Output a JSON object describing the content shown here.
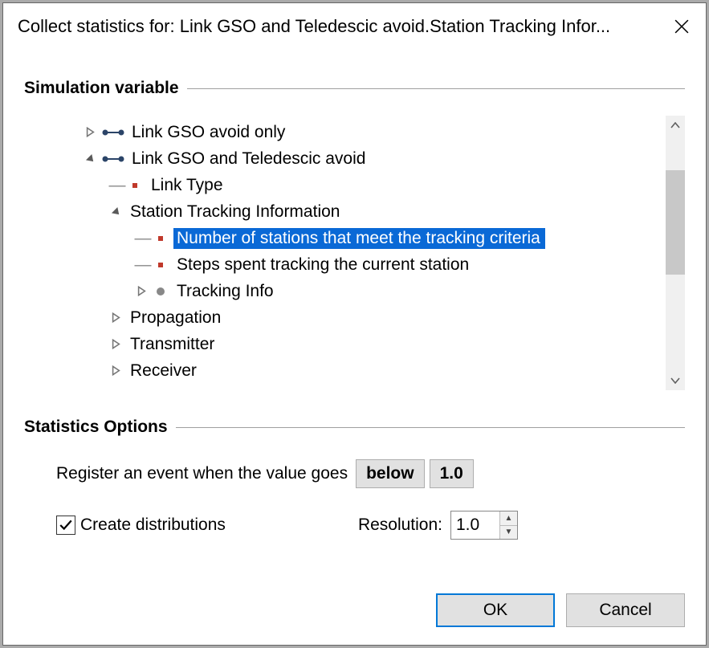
{
  "title": "Collect statistics for: Link GSO and Teledescic avoid.Station Tracking Infor...",
  "group_sim": "Simulation variable",
  "group_opts": "Statistics Options",
  "tree": {
    "n0": "Link GSO avoid only",
    "n1": "Link GSO and Teledescic avoid",
    "n2": "Link Type",
    "n3": "Station Tracking Information",
    "n4": "Number of stations that meet the tracking criteria",
    "n5": "Steps spent tracking the current station",
    "n6": "Tracking Info",
    "n7": "Propagation",
    "n8": "Transmitter",
    "n9": "Receiver"
  },
  "opts": {
    "register_prefix": "Register an event when the value goes",
    "below": "below",
    "threshold": "1.0",
    "create_dist": "Create distributions",
    "create_dist_checked": true,
    "resolution_label": "Resolution:",
    "resolution_value": "1.0"
  },
  "buttons": {
    "ok": "OK",
    "cancel": "Cancel"
  }
}
